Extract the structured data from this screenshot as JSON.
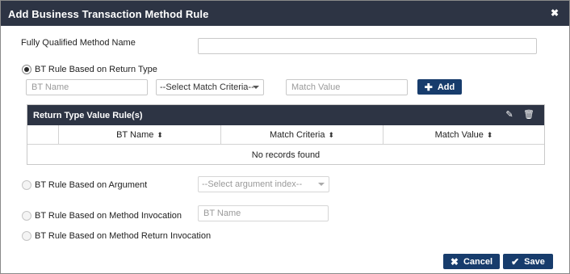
{
  "dialog": {
    "title": "Add Business Transaction Method Rule",
    "close_icon": "✖"
  },
  "form": {
    "fqmn_label": "Fully Qualified Method Name",
    "fqmn_value": "",
    "return_type_option": "BT Rule Based on Return Type",
    "return_type_checked": true,
    "bt_name_placeholder": "BT Name",
    "match_criteria_select": "--Select Match Criteria--",
    "match_value_placeholder": "Match Value",
    "add_label": "Add",
    "argument_option": "BT Rule Based on Argument",
    "argument_index_select": "--Select argument index--",
    "method_invocation_option": "BT Rule Based on Method Invocation",
    "method_invocation_placeholder": "BT Name",
    "method_return_invocation_option": "BT Rule Based on Method Return Invocation"
  },
  "table": {
    "title": "Return Type Value Rule(s)",
    "columns": [
      "BT Name",
      "Match Criteria",
      "Match Value"
    ],
    "rows": [],
    "empty_text": "No records found"
  },
  "footer": {
    "cancel_label": "Cancel",
    "save_label": "Save"
  },
  "colors": {
    "titlebar": "#2d3444",
    "button": "#173c6c"
  },
  "icons": {
    "close": "close-icon",
    "add": "plus-icon",
    "edit": "pencil-icon",
    "delete": "trash-icon",
    "sort": "sort-icon",
    "cancel": "x-icon",
    "save": "check-icon"
  }
}
